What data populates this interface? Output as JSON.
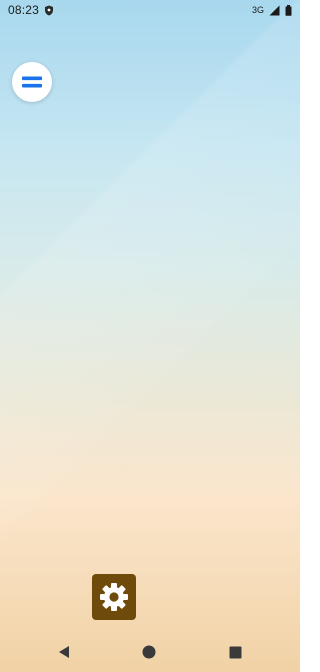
{
  "status_bar": {
    "time": "08:23",
    "network_type": "3G",
    "icons": [
      "shield-icon",
      "signal-icon",
      "battery-icon"
    ]
  },
  "floating_button": {
    "icon": "menu-icon",
    "accent_color": "#1a73e8"
  },
  "apps": [
    {
      "icon": "settings-gear-icon",
      "background": "#6e4b0a"
    }
  ],
  "navigation_bar": {
    "buttons": [
      "back-icon",
      "home-icon",
      "recents-icon"
    ]
  }
}
